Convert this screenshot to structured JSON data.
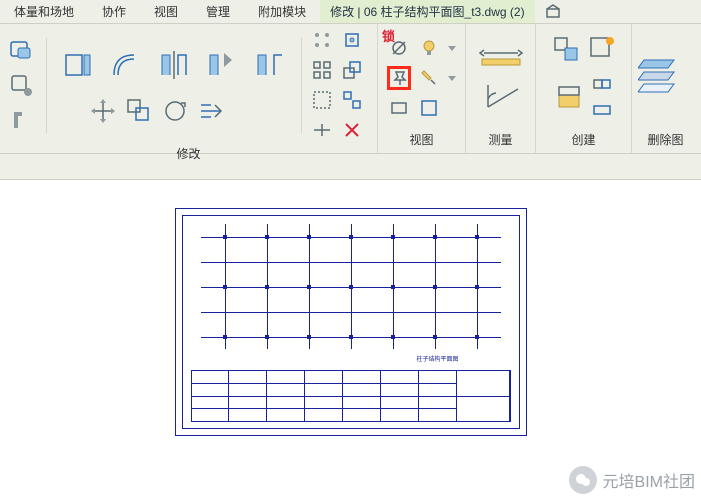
{
  "menu": {
    "mass_site": "体量和场地",
    "collaborate": "协作",
    "view": "视图",
    "manage": "管理",
    "addins": "附加模块",
    "active_tab": "修改 | 06 柱子结构平面图_t3.dwg (2)",
    "extra_icon": "⌂"
  },
  "panels": {
    "modify": "修改",
    "view": "视图",
    "measure": "测量",
    "create": "创建",
    "delete": "删除图"
  },
  "lock_label": "锁",
  "watermark": "元培BIM社团",
  "drawing_title": "柱子结构平面图"
}
